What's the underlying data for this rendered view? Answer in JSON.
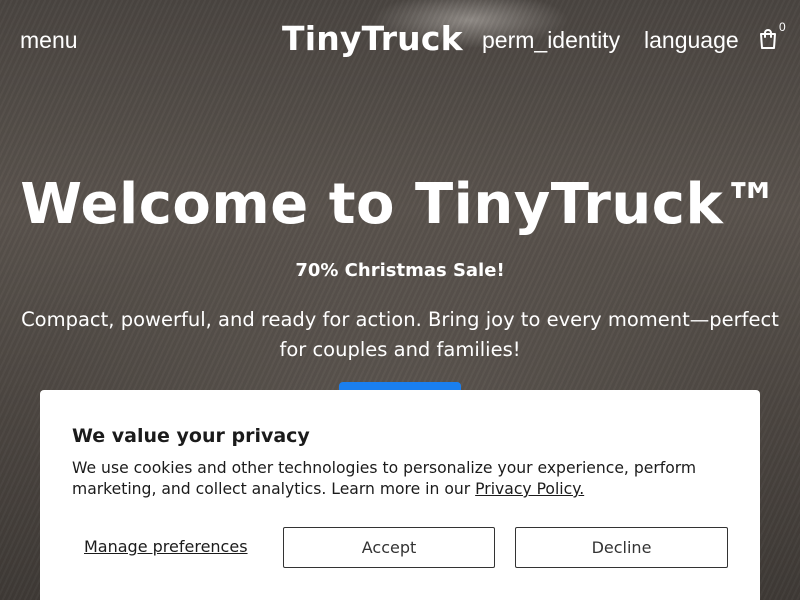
{
  "header": {
    "menu_label": "menu",
    "logo": "TinyTruck",
    "account_label": "perm_identity",
    "language_label": "language",
    "cart_count": "0"
  },
  "hero": {
    "title": "Welcome to TinyTruck™",
    "sale": "70% Christmas Sale!",
    "description": "Compact, powerful, and ready for action. Bring joy to every moment—perfect for couples and families!"
  },
  "consent": {
    "title": "We value your privacy",
    "text": "We use cookies and other technologies to personalize your experience, perform marketing, and collect analytics. Learn more in our ",
    "policy_link": "Privacy Policy.",
    "manage_label": "Manage preferences",
    "accept_label": "Accept",
    "decline_label": "Decline"
  },
  "icons": {
    "cart": "shopping-bag-icon"
  },
  "colors": {
    "cta": "#1a7ff0",
    "consent_bg": "#ffffff",
    "text_dark": "#1b1b1b"
  }
}
